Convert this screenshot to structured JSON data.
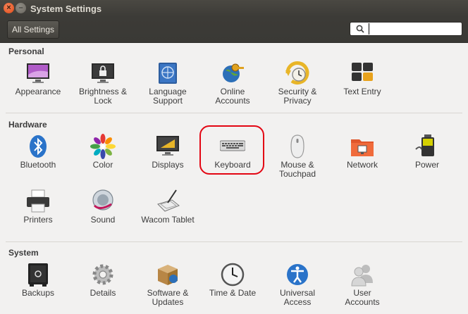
{
  "window": {
    "title": "System Settings"
  },
  "toolbar": {
    "all_settings_label": "All Settings",
    "search_value": ""
  },
  "sections": [
    {
      "title": "Personal",
      "items": [
        {
          "label": "Appearance"
        },
        {
          "label": "Brightness &\nLock"
        },
        {
          "label": "Language\nSupport"
        },
        {
          "label": "Online\nAccounts"
        },
        {
          "label": "Security &\nPrivacy"
        },
        {
          "label": "Text Entry"
        }
      ]
    },
    {
      "title": "Hardware",
      "items": [
        {
          "label": "Bluetooth"
        },
        {
          "label": "Color"
        },
        {
          "label": "Displays"
        },
        {
          "label": "Keyboard"
        },
        {
          "label": "Mouse &\nTouchpad"
        },
        {
          "label": "Network"
        },
        {
          "label": "Power"
        },
        {
          "label": "Printers"
        },
        {
          "label": "Sound"
        },
        {
          "label": "Wacom Tablet"
        }
      ]
    },
    {
      "title": "System",
      "items": [
        {
          "label": "Backups"
        },
        {
          "label": "Details"
        },
        {
          "label": "Software &\nUpdates"
        },
        {
          "label": "Time & Date"
        },
        {
          "label": "Universal\nAccess"
        },
        {
          "label": "User\nAccounts"
        }
      ]
    }
  ]
}
